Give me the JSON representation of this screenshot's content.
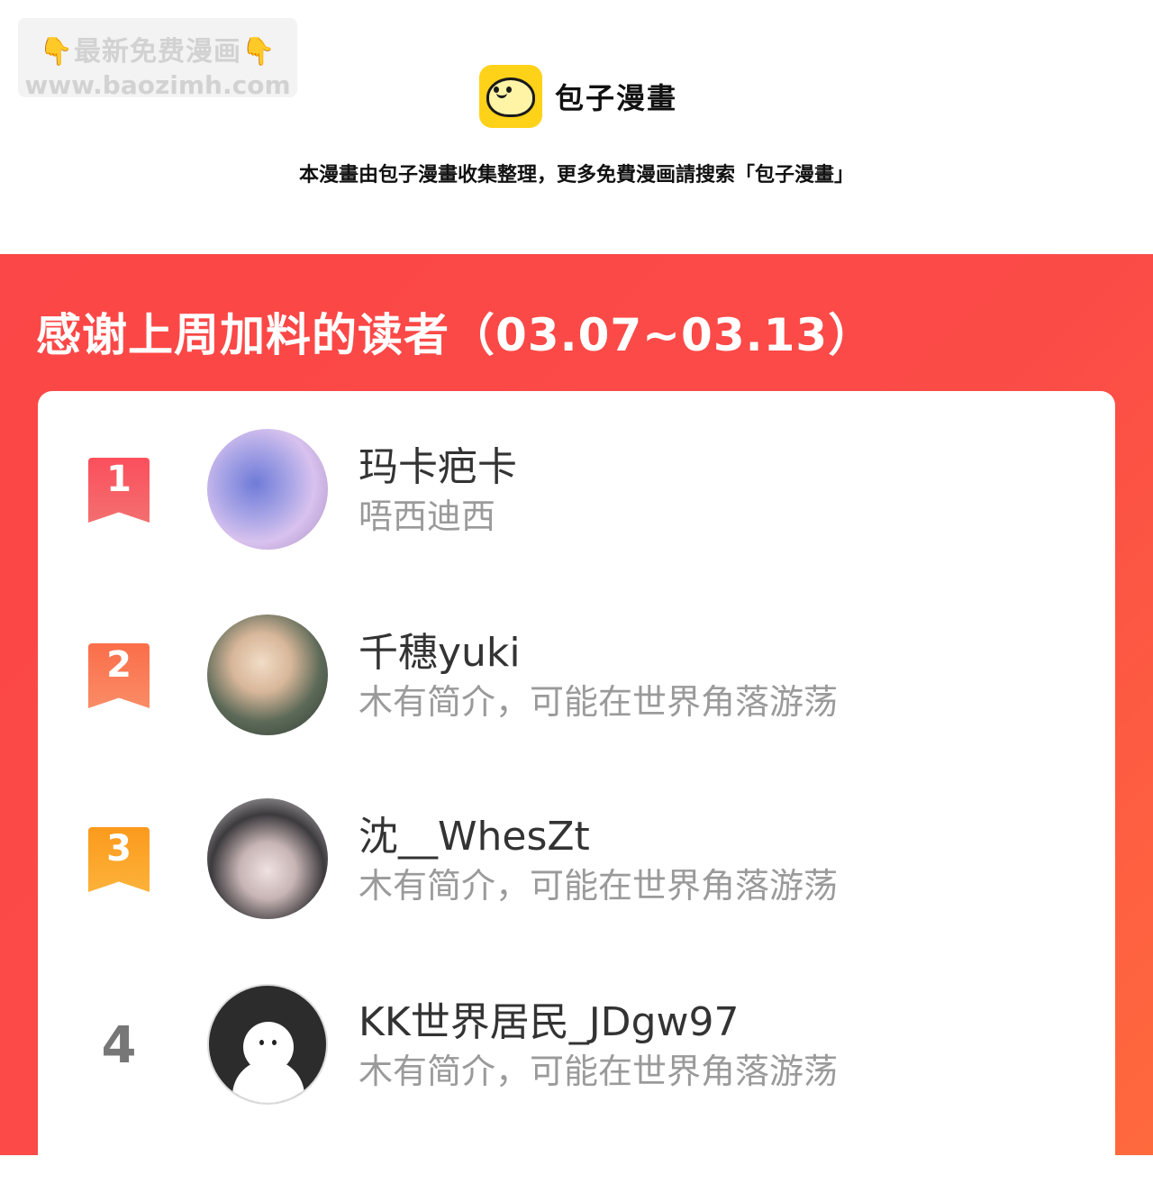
{
  "watermark": {
    "line1_left_icon": "pointing-down-hand-icon",
    "line1_text": "最新免费漫画",
    "line1_right_icon": "pointing-down-hand-icon",
    "line2_text": "www.baozimh.com"
  },
  "header": {
    "logo_icon": "baozi-bun-logo-icon",
    "logo_text": "包子漫畫",
    "notice": "本漫畫由包子漫畫收集整理，更多免費漫画請搜索「包子漫畫」"
  },
  "panel": {
    "title": "感谢上周加料的读者（03.07~03.13）",
    "colors": {
      "accent": "#fb4747",
      "accent_end": "#ff6a3d"
    }
  },
  "readers": [
    {
      "rank": "1",
      "name": "玛卡疤卡",
      "bio": "唔西迪西",
      "avatar": "moon-avatar",
      "badge_color": "#fb4f5c"
    },
    {
      "rank": "2",
      "name": "千穗yuki",
      "bio": "木有简介，可能在世界角落游荡",
      "avatar": "anime-boy-avatar",
      "badge_color": "#fb6e4a"
    },
    {
      "rank": "3",
      "name": "沈__WhesZt",
      "bio": "木有简介，可能在世界角落游荡",
      "avatar": "girl-photo-avatar",
      "badge_color": "#fb9a1c"
    },
    {
      "rank": "4",
      "name": "KK世界居民_JDgw97",
      "bio": "木有简介，可能在世界角落游荡",
      "avatar": "default-ghost-avatar",
      "badge_color": ""
    }
  ]
}
